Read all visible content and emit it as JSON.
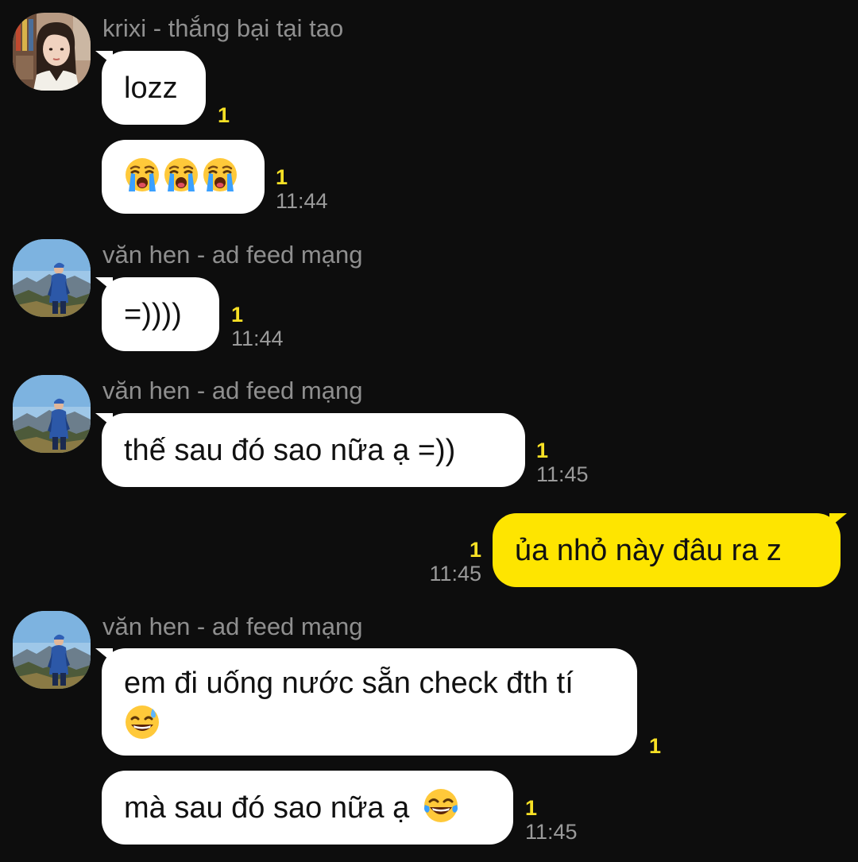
{
  "conversation": {
    "messages": [
      {
        "sender": "krixi - thắng bại tại tao",
        "bubbles": [
          {
            "text": "lozz",
            "count": "1"
          },
          {
            "text": "😭😭😭",
            "count": "1",
            "time": "11:44"
          }
        ]
      },
      {
        "sender": "văn hen - ad feed mạng",
        "bubbles": [
          {
            "text": "=))))",
            "count": "1",
            "time": "11:44"
          }
        ]
      },
      {
        "sender": "văn hen - ad feed mạng",
        "bubbles": [
          {
            "text": "thế sau đó sao nữa ạ =))",
            "count": "1",
            "time": "11:45"
          }
        ]
      },
      {
        "sender": "me",
        "bubbles": [
          {
            "text": "ủa nhỏ này đâu ra z",
            "count": "1",
            "time": "11:45"
          }
        ]
      },
      {
        "sender": "văn hen - ad feed mạng",
        "bubbles": [
          {
            "text": "em đi uống nước sẵn check đth tí",
            "emoji": "sweat-smile-emoji",
            "count": "1"
          },
          {
            "text": "mà sau đó sao nữa ạ",
            "emoji": "joy-emoji",
            "count": "1",
            "time": "11:45"
          }
        ]
      }
    ]
  },
  "colors": {
    "background": "#0d0d0d",
    "incoming_bubble": "#ffffff",
    "outgoing_bubble": "#fee500",
    "unread_count": "#f7e025",
    "sender_name": "#8f8f8f",
    "timestamp": "#9a9a9a"
  }
}
